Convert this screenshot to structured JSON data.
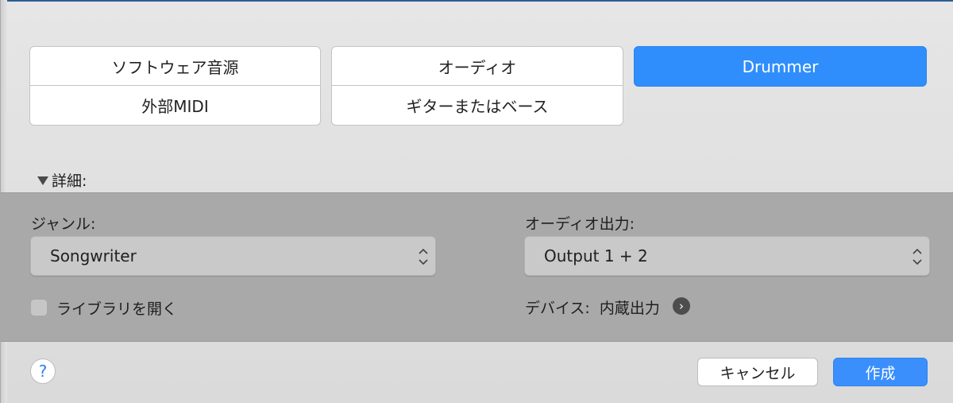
{
  "track_types": {
    "software_instrument": "ソフトウェア音源",
    "audio": "オーディオ",
    "drummer": "Drummer",
    "external_midi": "外部MIDI",
    "guitar_or_bass": "ギターまたはベース"
  },
  "details": {
    "toggle_label": "詳細:",
    "genre": {
      "label": "ジャンル:",
      "value": "Songwriter"
    },
    "audio_output": {
      "label": "オーディオ出力:",
      "value": "Output 1 + 2"
    },
    "open_library": {
      "label": "ライブラリを開く",
      "checked": false
    },
    "device": {
      "label": "デバイス:",
      "value": "内蔵出力",
      "arrow_glyph": "›"
    }
  },
  "footer": {
    "help": "?",
    "cancel": "キャンセル",
    "create": "作成"
  },
  "colors": {
    "accent": "#2f8efb",
    "panel": "#a9a9a9",
    "dialog": "#e0e0e0"
  }
}
